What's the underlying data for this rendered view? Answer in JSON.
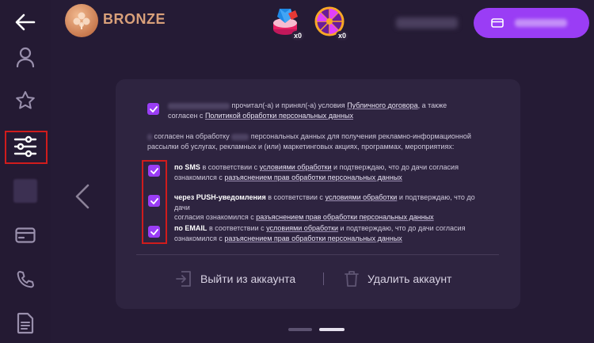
{
  "header": {
    "rank_label": "BRONZE",
    "games": [
      {
        "icon": "gems-cake-icon",
        "count": "x0"
      },
      {
        "icon": "fortune-wheel-icon",
        "count": "x0"
      }
    ]
  },
  "sidebar": {
    "items": [
      {
        "icon": "arrow-left-icon"
      },
      {
        "icon": "user-icon"
      },
      {
        "icon": "star-icon"
      },
      {
        "icon": "sliders-icon",
        "highlighted": true
      },
      {
        "icon": "blurred-item-icon"
      },
      {
        "icon": "credit-card-icon"
      },
      {
        "icon": "phone-icon"
      },
      {
        "icon": "document-icon"
      }
    ]
  },
  "consent": {
    "terms_text_1": "прочитал(-а) и принял(-а) условия",
    "terms_link_1": "Публичного договора",
    "terms_text_2": ", а также",
    "terms_text_3": "согласен с",
    "terms_link_2": "Политикой обработки персональных данных",
    "intro_1": "согласен на обработку",
    "intro_2": "персональных данных для получения рекламно-информационной",
    "intro_3": "рассылки об услугах, рекламных и (или) маркетинговых акциях, программах, мероприятиях:",
    "options": [
      {
        "channel": "по SMS",
        "text_a": "в соответствии с",
        "link_a": "условиями обработки",
        "text_b": "и подтверждаю, что до дачи согласия",
        "text_c": "ознакомился с",
        "link_b": "разъяснением прав обработки персональных данных",
        "checked": true
      },
      {
        "channel": "через PUSH-уведомления",
        "text_a": "в соответствии с",
        "link_a": "условиями обработки",
        "text_b": "и подтверждаю, что до дачи",
        "text_c": "согласия ознакомился с",
        "link_b": "разъяснением прав обработки персональных данных",
        "checked": true
      },
      {
        "channel": "по EMAIL",
        "text_a": "в соответствии с",
        "link_a": "условиями обработки",
        "text_b": "и подтверждаю, что до дачи согласия",
        "text_c": "ознакомился с",
        "link_b": "разъяснением прав обработки персональных данных",
        "checked": true
      }
    ]
  },
  "actions": {
    "logout_label": "Выйти из аккаунта",
    "delete_label": "Удалить аккаунт"
  },
  "colors": {
    "accent": "#9a3df5",
    "background": "#251b35",
    "card": "#2e2440",
    "highlight": "#d01c1c"
  }
}
